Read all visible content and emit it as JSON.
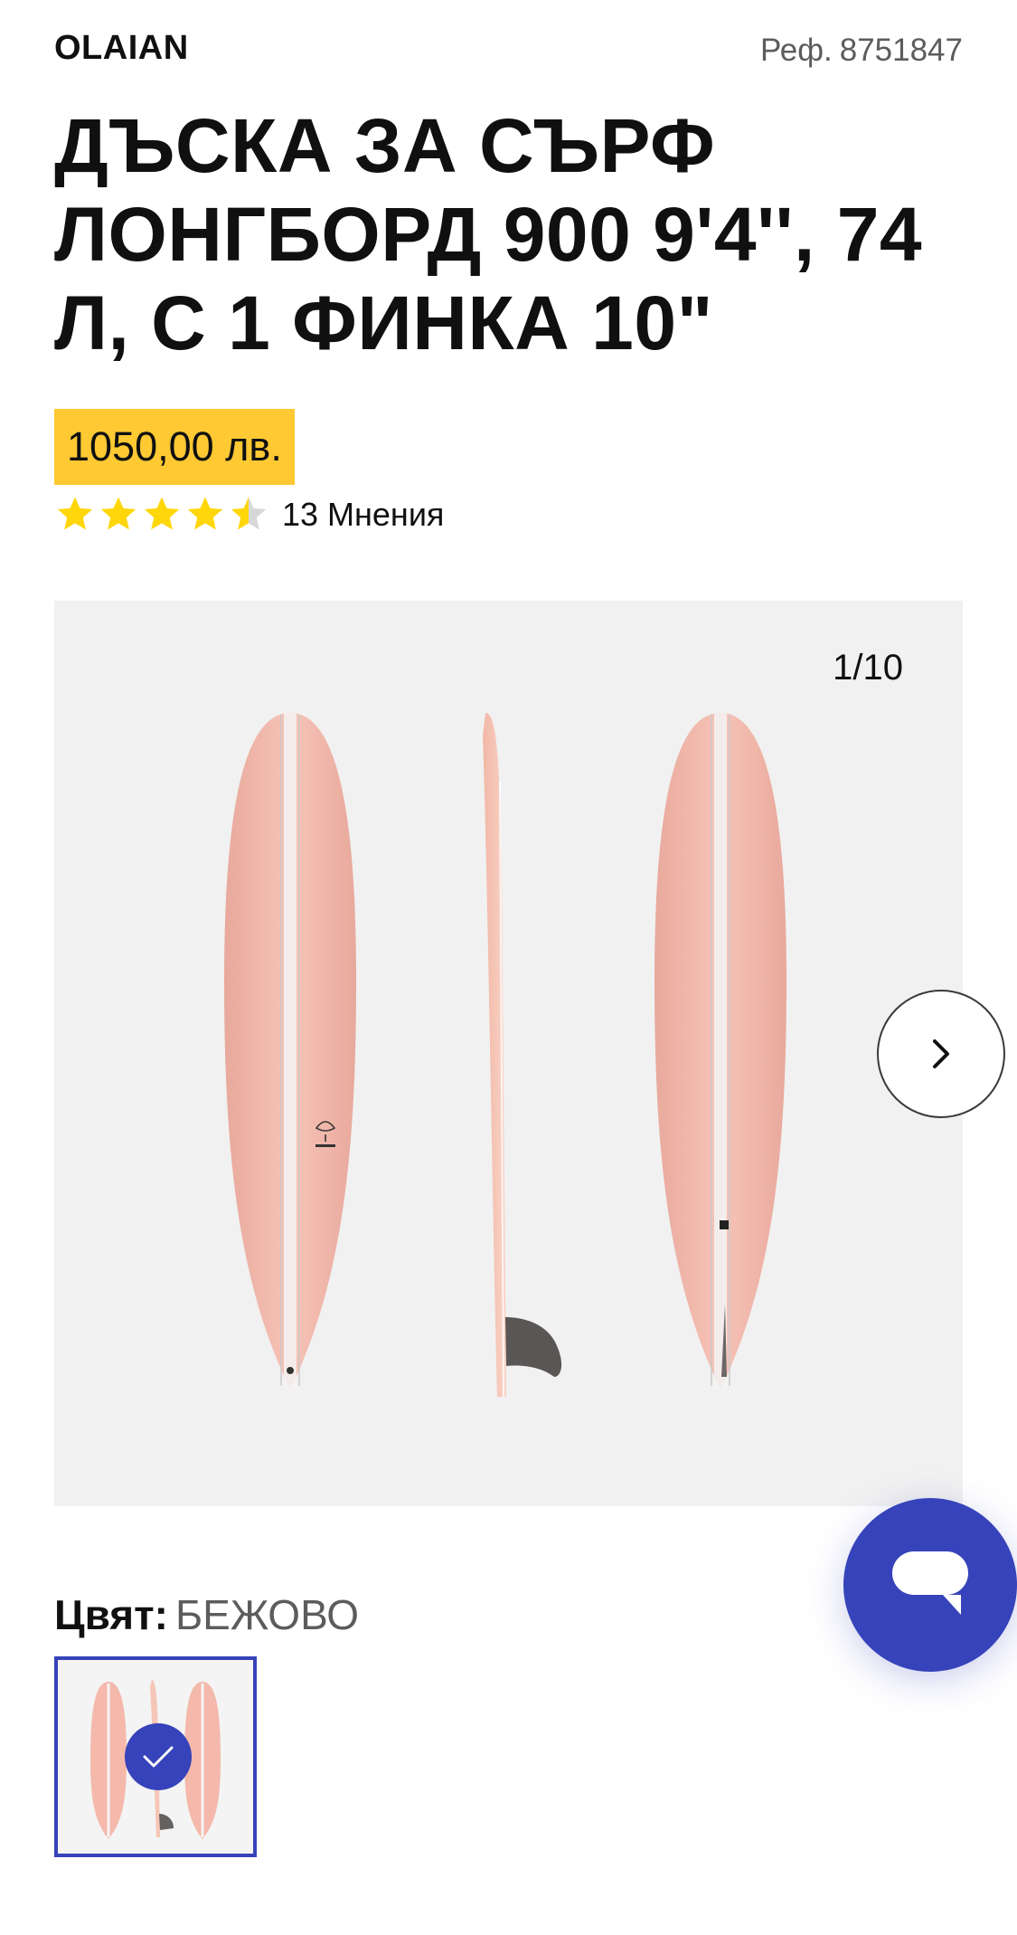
{
  "product": {
    "brand": "OLAIAN",
    "ref_label": "Реф.",
    "ref_number": "8751847",
    "title": "ДЪСКА ЗА СЪРФ ЛОНГБОРД 900 9'4'', 74 Л, С 1 ФИНКА 10\"",
    "price": "1050,00 лв.",
    "rating": {
      "value": 4.5,
      "max": 5,
      "reviews_label": "13 Мнения"
    }
  },
  "gallery": {
    "counter": "1/10",
    "next_icon": "chevron-right-icon"
  },
  "color": {
    "label": "Цвят:",
    "value": "БЕЖОВО"
  },
  "chat": {
    "icon": "chat-bubble-icon"
  },
  "colors": {
    "accent": "#3643ba",
    "price_bg": "#ffc933",
    "star": "#ffd60a",
    "board": "#f6c1b6"
  }
}
